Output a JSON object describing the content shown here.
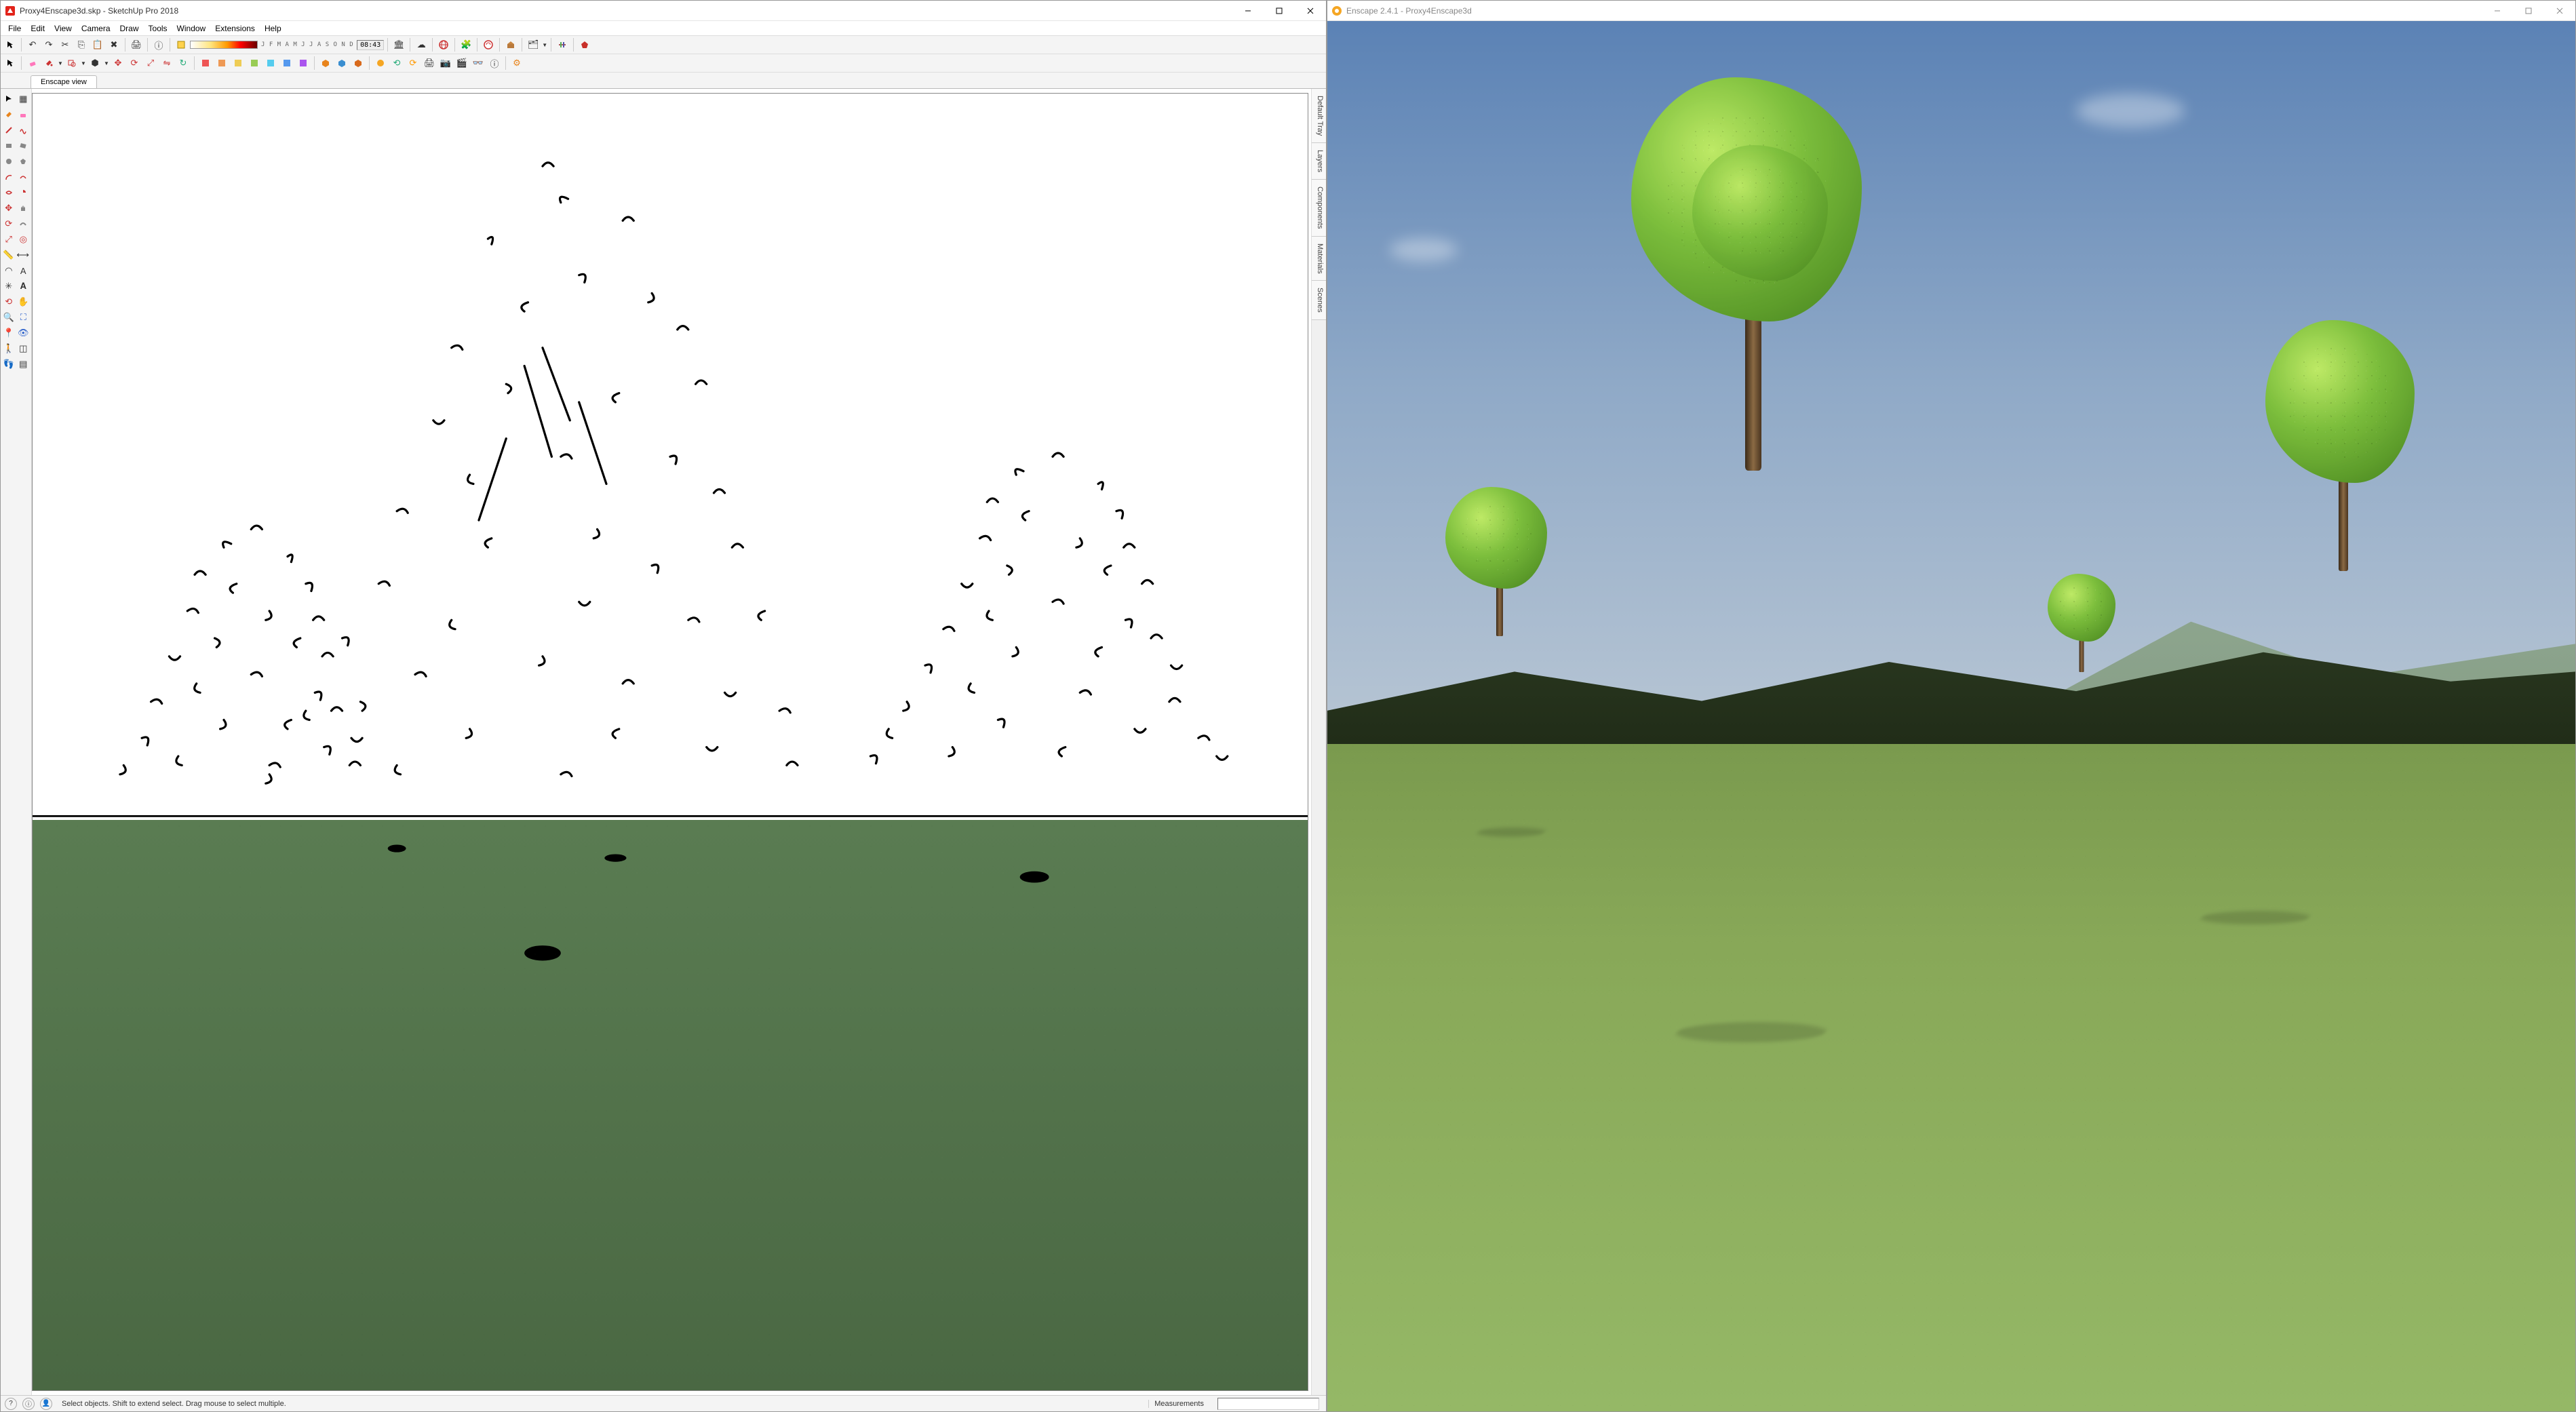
{
  "left_window": {
    "title": "Proxy4Enscape3d.skp - SketchUp Pro 2018",
    "menus": [
      "File",
      "Edit",
      "View",
      "Camera",
      "Draw",
      "Tools",
      "Window",
      "Extensions",
      "Help"
    ],
    "months": "J F M A M J J A S O N D",
    "time": "08:43",
    "scene_tab": "Enscape view",
    "tray_tabs": [
      "Default Tray",
      "Layers",
      "Components",
      "Materials",
      "Scenes"
    ],
    "status_hint": "Select objects. Shift to extend select. Drag mouse to select multiple.",
    "measurements_label": "Measurements"
  },
  "right_window": {
    "title": "Enscape 2.4.1 - Proxy4Enscape3d"
  },
  "toolbar1_icons": [
    "select-arrow",
    "separator",
    "undo",
    "redo",
    "cut",
    "copy",
    "paste",
    "delete",
    "separator",
    "print",
    "separator",
    "model-info",
    "separator",
    "shadow-toggle",
    "shadow-gradient",
    "month-strip",
    "time-box",
    "separator",
    "warehouse",
    "separator",
    "cloud",
    "separator",
    "globe",
    "separator",
    "extension-wh",
    "separator",
    "globe-red",
    "separator",
    "profile",
    "separator",
    "layers-icon",
    "layers-dd",
    "separator",
    "ruler",
    "separator",
    "ruby"
  ],
  "toolbar2_icons": [
    "pointer",
    "separator",
    "eraser",
    "paint",
    "dd",
    "shape",
    "dd",
    "stamp",
    "dd",
    "move-copy",
    "rotate",
    "scale",
    "mirror",
    "reload",
    "separator",
    "r1",
    "r2",
    "r3",
    "r4",
    "r5",
    "r6",
    "r7",
    "separator",
    "box1",
    "box2",
    "box3",
    "separator",
    "en1",
    "en2",
    "en3",
    "en4",
    "en5",
    "en6",
    "en7",
    "en8",
    "en9",
    "separator",
    "gear"
  ],
  "colors": {
    "accent": "#d8e6f2",
    "grass_left": "#5a7c52",
    "grass_right": "#88a858",
    "sky_right": "#7a9cc0"
  }
}
